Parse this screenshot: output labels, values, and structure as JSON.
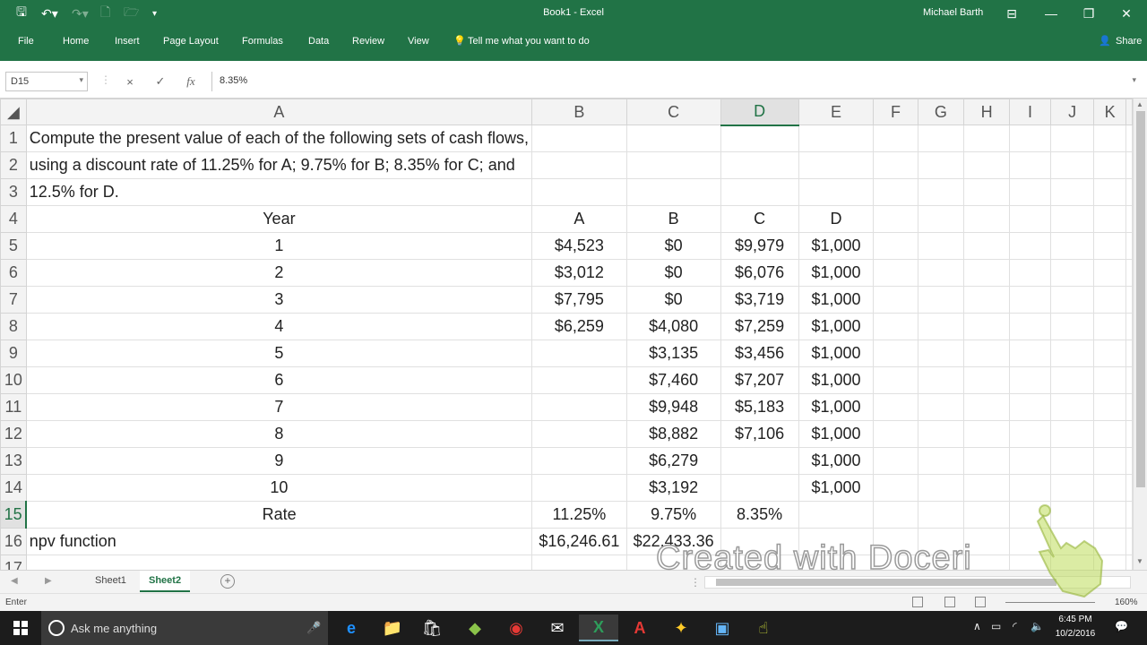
{
  "window": {
    "title": "Book1 - Excel",
    "user": "Michael Barth",
    "tabs": [
      "File",
      "Home",
      "Insert",
      "Page Layout",
      "Formulas",
      "Data",
      "Review",
      "View"
    ],
    "tell_me": "Tell me what you want to do",
    "share": "Share",
    "accent_color": "#217346"
  },
  "formula_bar": {
    "name_box": "D15",
    "formula": "8.35%",
    "cancel_icon": "×",
    "enter_icon": "✓",
    "fx_label": "fx"
  },
  "columns": [
    "A",
    "B",
    "C",
    "D",
    "E",
    "F",
    "G",
    "H",
    "I",
    "J",
    "K"
  ],
  "selected_cell": "D15",
  "rows": [
    {
      "n": "1",
      "cells": [
        "Compute the present value of each of the following sets of cash flows,",
        "",
        "",
        "",
        ""
      ]
    },
    {
      "n": "2",
      "cells": [
        "using a discount rate of 11.25% for A; 9.75% for B; 8.35% for C; and",
        "",
        "",
        "",
        ""
      ]
    },
    {
      "n": "3",
      "cells": [
        "12.5% for D.",
        "",
        "",
        "",
        ""
      ]
    },
    {
      "n": "4",
      "cells": [
        "Year",
        "A",
        "B",
        "C",
        "D"
      ]
    },
    {
      "n": "5",
      "cells": [
        "1",
        "$4,523",
        "$0",
        "$9,979",
        "$1,000"
      ]
    },
    {
      "n": "6",
      "cells": [
        "2",
        "$3,012",
        "$0",
        "$6,076",
        "$1,000"
      ]
    },
    {
      "n": "7",
      "cells": [
        "3",
        "$7,795",
        "$0",
        "$3,719",
        "$1,000"
      ]
    },
    {
      "n": "8",
      "cells": [
        "4",
        "$6,259",
        "$4,080",
        "$7,259",
        "$1,000"
      ]
    },
    {
      "n": "9",
      "cells": [
        "5",
        "",
        "$3,135",
        "$3,456",
        "$1,000"
      ]
    },
    {
      "n": "10",
      "cells": [
        "6",
        "",
        "$7,460",
        "$7,207",
        "$1,000"
      ]
    },
    {
      "n": "11",
      "cells": [
        "7",
        "",
        "$9,948",
        "$5,183",
        "$1,000"
      ]
    },
    {
      "n": "12",
      "cells": [
        "8",
        "",
        "$8,882",
        "$7,106",
        "$1,000"
      ]
    },
    {
      "n": "13",
      "cells": [
        "9",
        "",
        "$6,279",
        "",
        "$1,000"
      ]
    },
    {
      "n": "14",
      "cells": [
        "10",
        "",
        "$3,192",
        "",
        "$1,000"
      ]
    },
    {
      "n": "15",
      "cells": [
        "Rate",
        "11.25%",
        "9.75%",
        "8.35%",
        ""
      ]
    },
    {
      "n": "16",
      "cells": [
        "npv function",
        "$16,246.61",
        "$22,433.36",
        "",
        ""
      ]
    },
    {
      "n": "17",
      "cells": [
        "",
        "",
        "",
        "",
        ""
      ]
    }
  ],
  "sheets": [
    "Sheet1",
    "Sheet2"
  ],
  "active_sheet": "Sheet2",
  "status": {
    "mode": "Enter",
    "zoom": "160%"
  },
  "taskbar": {
    "search_placeholder": "Ask me anything",
    "time": "6:45 PM",
    "date": "10/2/2016"
  },
  "watermark": "Created with Doceri"
}
